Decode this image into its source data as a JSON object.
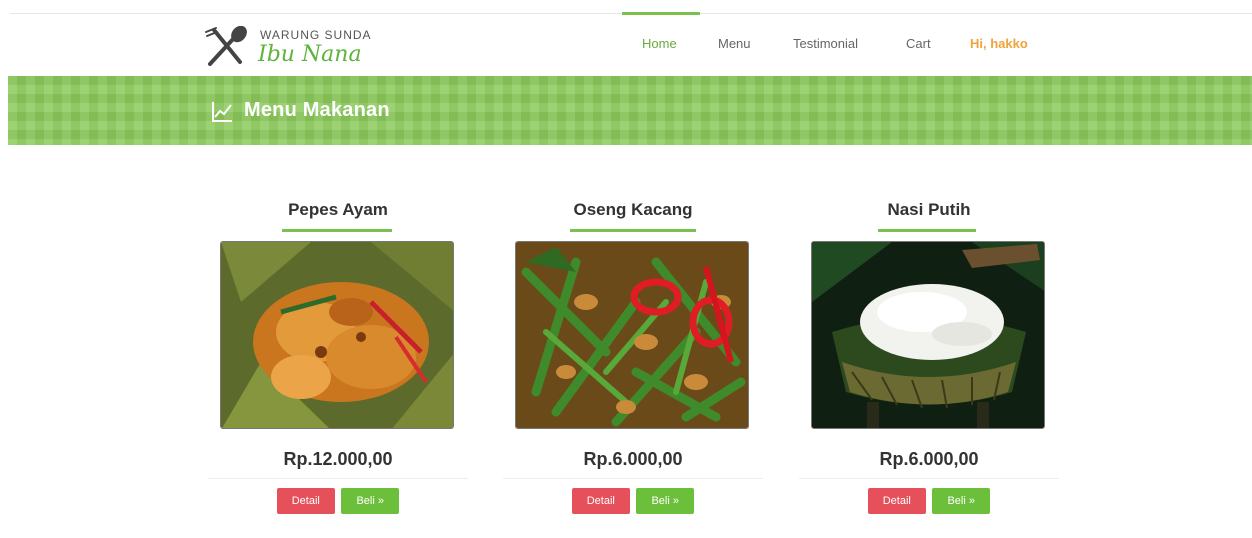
{
  "brand": {
    "title": "WARUNG SUNDA",
    "script": "Ibu Nana"
  },
  "nav": {
    "items": [
      "Home",
      "Menu",
      "Testimonial",
      "Cart"
    ],
    "user": "Hi, hakko"
  },
  "banner": {
    "title": "Menu Makanan"
  },
  "products": [
    {
      "name": "Pepes Ayam",
      "price": "Rp.12.000,00",
      "detail": "Detail",
      "buy": "Beli »"
    },
    {
      "name": "Oseng Kacang",
      "price": "Rp.6.000,00",
      "detail": "Detail",
      "buy": "Beli »"
    },
    {
      "name": "Nasi Putih",
      "price": "Rp.6.000,00",
      "detail": "Detail",
      "buy": "Beli »"
    }
  ],
  "colors": {
    "accent": "#7cc04e",
    "banner": "#8cca5c",
    "user": "#f0a33a",
    "detail_button": "#e6505a",
    "buy_button": "#6cbf3a"
  },
  "icons": {
    "logo": "fork-spoon-icon",
    "banner": "chart-line-icon"
  }
}
